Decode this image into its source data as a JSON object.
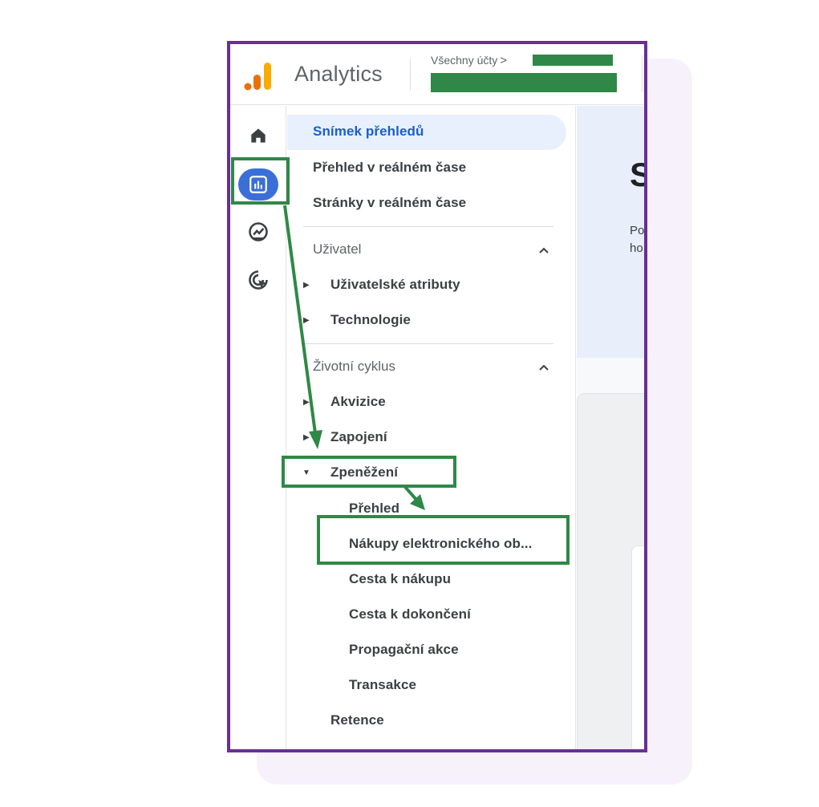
{
  "app": {
    "title": "Analytics"
  },
  "header": {
    "accounts_label": "Všechny účty",
    "accounts_chevron": ">"
  },
  "rail": {
    "icons": [
      {
        "name": "home-icon",
        "active": false
      },
      {
        "name": "reports-icon",
        "active": true
      },
      {
        "name": "explore-icon",
        "active": false
      },
      {
        "name": "advertising-icon",
        "active": false
      }
    ]
  },
  "nav": {
    "top_items": [
      "Snímek přehledů",
      "Přehled v reálném čase",
      "Stránky v reálném čase"
    ],
    "sections": [
      {
        "label": "Uživatel",
        "items": [
          "Uživatelské atributy",
          "Technologie"
        ]
      },
      {
        "label": "Životní cyklus",
        "items": [
          "Akvizice",
          "Zapojení",
          "Zpeněžení"
        ]
      }
    ],
    "expanded_subitems": [
      "Přehled",
      "Nákupy elektronického ob...",
      "Cesta k nákupu",
      "Cesta k dokončení",
      "Propagační akce",
      "Transakce"
    ],
    "retention": "Retence"
  },
  "main": {
    "hero_big": "S",
    "hero_small_1": "Po",
    "hero_small_2": "ho"
  },
  "colors": {
    "frame": "#6a2e96",
    "annotation": "#2f8847",
    "active": "#3b6fd8",
    "selected_bg": "#e8f0fe"
  }
}
